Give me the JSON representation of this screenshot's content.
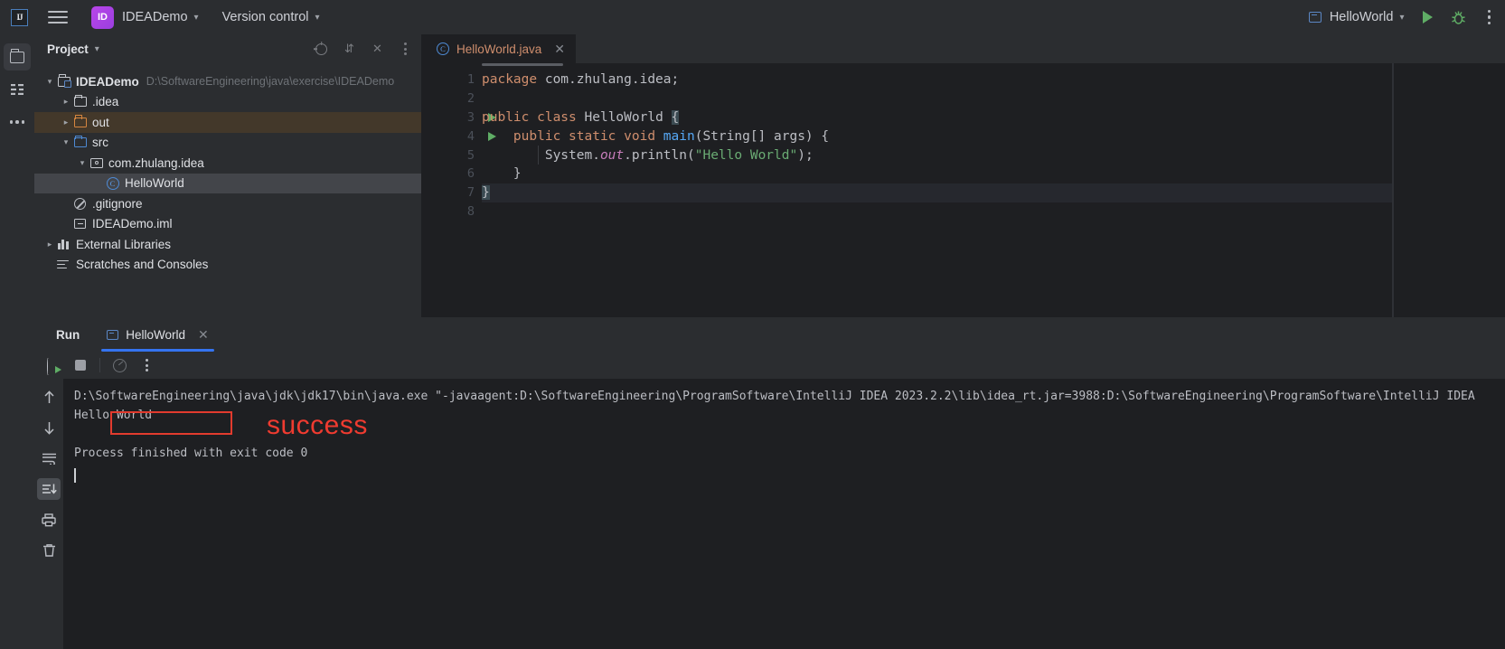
{
  "toolbar": {
    "logo_text": "IJ",
    "menu_icon": "hamburger-icon",
    "project_badge": "ID",
    "project_name": "IDEADemo",
    "version_control": "Version control",
    "run_config_name": "HelloWorld",
    "run_icon": "run-play-icon",
    "debug_icon": "debug-bug-icon",
    "more_icon": "more-vertical-icon"
  },
  "rail": {
    "project_icon": "project-folder-icon",
    "structure_icon": "structure-icon",
    "more_icon": "more-horizontal-icon"
  },
  "project_panel": {
    "title": "Project",
    "actions": [
      "select-opened-file-icon",
      "expand-collapse-icon",
      "hide-icon",
      "options-icon"
    ],
    "tree": [
      {
        "label": "IDEADemo",
        "path": "D:\\SoftwareEngineering\\java\\exercise\\IDEADemo",
        "indent": 0,
        "arrow": "down",
        "icon": "module-icon",
        "bold": true,
        "state": "none"
      },
      {
        "label": ".idea",
        "path": "",
        "indent": 1,
        "arrow": "right",
        "icon": "folder-gray-icon",
        "bold": false,
        "state": "none"
      },
      {
        "label": "out",
        "path": "",
        "indent": 1,
        "arrow": "right",
        "icon": "folder-orange-icon",
        "bold": false,
        "state": "selected-out"
      },
      {
        "label": "src",
        "path": "",
        "indent": 1,
        "arrow": "down",
        "icon": "folder-blue-icon",
        "bold": false,
        "state": "none"
      },
      {
        "label": "com.zhulang.idea",
        "path": "",
        "indent": 2,
        "arrow": "down",
        "icon": "package-icon",
        "bold": false,
        "state": "none"
      },
      {
        "label": "HelloWorld",
        "path": "",
        "indent": 3,
        "arrow": "none",
        "icon": "java-class-icon",
        "bold": false,
        "state": "selected-file"
      },
      {
        "label": ".gitignore",
        "path": "",
        "indent": 1,
        "arrow": "none",
        "icon": "gitignore-icon",
        "bold": false,
        "state": "none"
      },
      {
        "label": "IDEADemo.iml",
        "path": "",
        "indent": 1,
        "arrow": "none",
        "icon": "iml-file-icon",
        "bold": false,
        "state": "none"
      },
      {
        "label": "External Libraries",
        "path": "",
        "indent": 0,
        "arrow": "right",
        "icon": "external-libraries-icon",
        "bold": false,
        "state": "none"
      },
      {
        "label": "Scratches and Consoles",
        "path": "",
        "indent": 0,
        "arrow": "none",
        "icon": "scratches-icon",
        "bold": false,
        "state": "none"
      }
    ]
  },
  "editor": {
    "tab_name": "HelloWorld.java",
    "tab_icon": "java-class-icon",
    "close_icon": "close-icon",
    "line_numbers": [
      "1",
      "2",
      "3",
      "4",
      "5",
      "6",
      "7",
      "8"
    ],
    "gutter_run_lines": [
      3,
      4
    ],
    "current_line": 7,
    "code_lines": [
      {
        "n": 1,
        "tokens": [
          {
            "t": "package ",
            "c": "kw"
          },
          {
            "t": "com.zhulang.idea;",
            "c": "plain"
          }
        ]
      },
      {
        "n": 2,
        "tokens": []
      },
      {
        "n": 3,
        "tokens": [
          {
            "t": "public class ",
            "c": "kw"
          },
          {
            "t": "HelloWorld ",
            "c": "plain"
          },
          {
            "t": "{",
            "c": "brmatch"
          }
        ]
      },
      {
        "n": 4,
        "tokens": [
          {
            "t": "    public static void ",
            "c": "kw"
          },
          {
            "t": "main",
            "c": "fn"
          },
          {
            "t": "(String[] args) {",
            "c": "plain"
          }
        ]
      },
      {
        "n": 5,
        "tokens": [
          {
            "t": "        System.",
            "c": "plain"
          },
          {
            "t": "out",
            "c": "stat"
          },
          {
            "t": ".println(",
            "c": "plain"
          },
          {
            "t": "\"Hello World\"",
            "c": "str"
          },
          {
            "t": ");",
            "c": "plain"
          }
        ]
      },
      {
        "n": 6,
        "tokens": [
          {
            "t": "    }",
            "c": "plain"
          }
        ]
      },
      {
        "n": 7,
        "tokens": [
          {
            "t": "}",
            "c": "brmatch"
          }
        ]
      },
      {
        "n": 8,
        "tokens": []
      }
    ]
  },
  "run_panel": {
    "title": "Run",
    "tab_name": "HelloWorld",
    "tab_icon": "run-config-icon",
    "close_icon": "close-icon",
    "toolbar_icons": [
      "rerun-icon",
      "stop-icon",
      "profiler-icon",
      "more-vertical-icon"
    ],
    "side_icons": [
      "scroll-up-icon",
      "scroll-down-icon",
      "soft-wrap-icon",
      "scroll-to-end-icon",
      "print-icon",
      "trash-icon"
    ],
    "console": {
      "command_line": "D:\\SoftwareEngineering\\java\\jdk\\jdk17\\bin\\java.exe \"-javaagent:D:\\SoftwareEngineering\\ProgramSoftware\\IntelliJ IDEA 2023.2.2\\lib\\idea_rt.jar=3988:D:\\SoftwareEngineering\\ProgramSoftware\\IntelliJ IDEA",
      "output_line": "Hello World",
      "exit_line": "Process finished with exit code 0"
    },
    "annotation": {
      "highlight_target": "Hello World",
      "label": "success",
      "color": "#ef3b30"
    }
  }
}
